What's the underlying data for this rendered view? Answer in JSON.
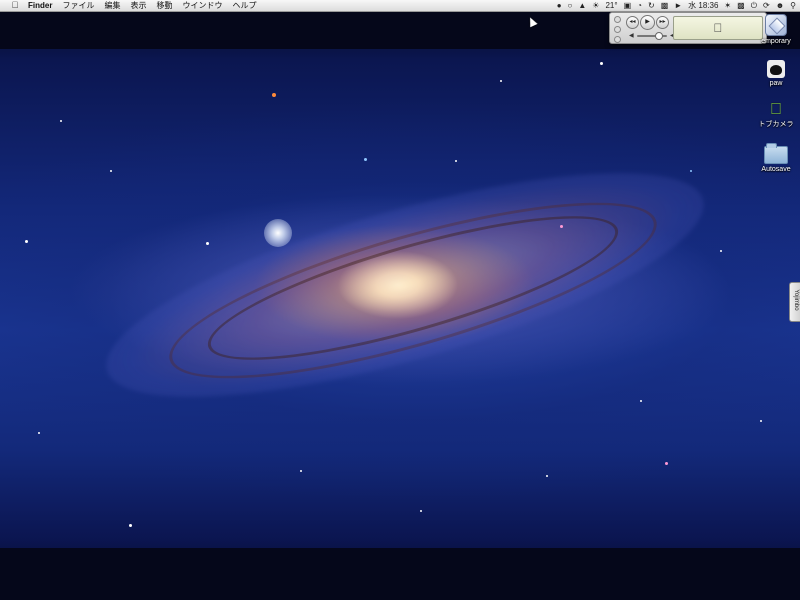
{
  "menubar": {
    "apple_icon": "apple-icon",
    "app_name": "Finder",
    "items": [
      "ファイル",
      "編集",
      "表示",
      "移動",
      "ウインドウ",
      "ヘルプ"
    ],
    "status": {
      "temperature": "21°",
      "clock": "水 18:36"
    }
  },
  "mini_player": {
    "prev": "◂◂",
    "play": "▶",
    "next": "▸▸",
    "display_logo": ""
  },
  "desktop_icons": [
    {
      "name": "emporary",
      "icon": "disk-icon"
    },
    {
      "name": "paw",
      "icon": "cat-icon"
    },
    {
      "name": "トブカメラ",
      "icon": "apple-camera-icon"
    },
    {
      "name": "Autosave",
      "icon": "folder-icon"
    }
  ],
  "side_tab": {
    "label": "Yojimbo"
  }
}
